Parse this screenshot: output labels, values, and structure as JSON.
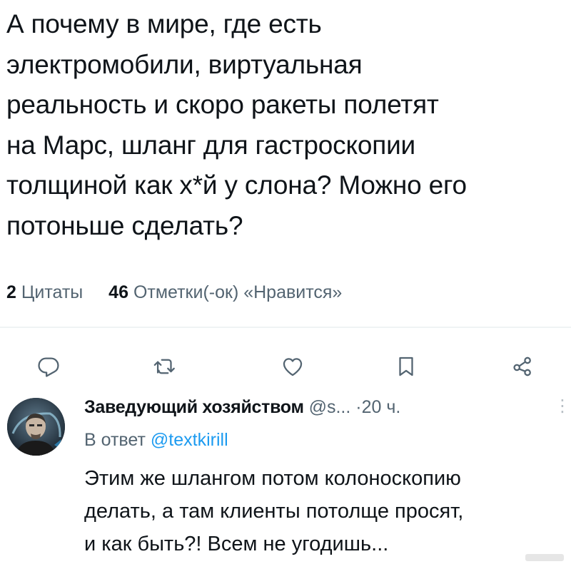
{
  "tweet": {
    "text_lines": [
      "А почему в мире, где есть",
      "электромобили, виртуальная",
      "реальность и скоро ракеты полетят",
      "на Марс, шланг для гастроскопии",
      "толщиной как х*й у слона? Можно его",
      "потоньше сделать?"
    ]
  },
  "stats": {
    "quotes_count": "2",
    "quotes_label": "Цитаты",
    "likes_count": "46",
    "likes_label": "Отметки(-ок) «Нравится»"
  },
  "actions": {
    "icons": [
      "reply-icon",
      "retweet-icon",
      "like-icon",
      "bookmark-icon",
      "share-icon"
    ],
    "icon_color": "#536471"
  },
  "reply": {
    "author_name": "Заведующий хозяйством",
    "author_handle": "@s...",
    "separator": "·",
    "timestamp": "20 ч.",
    "reply_to_prefix": "В ответ",
    "reply_to_mention": "@textkirill",
    "text_lines": [
      "Этим же шлангом потом колоноскопию",
      "делать, а там клиенты потолще просят,",
      "и как быть?! Всем не угодишь..."
    ]
  },
  "colors": {
    "text_primary": "#0f1419",
    "text_secondary": "#536471",
    "link": "#1d9bf0",
    "divider": "#eff3f4"
  }
}
